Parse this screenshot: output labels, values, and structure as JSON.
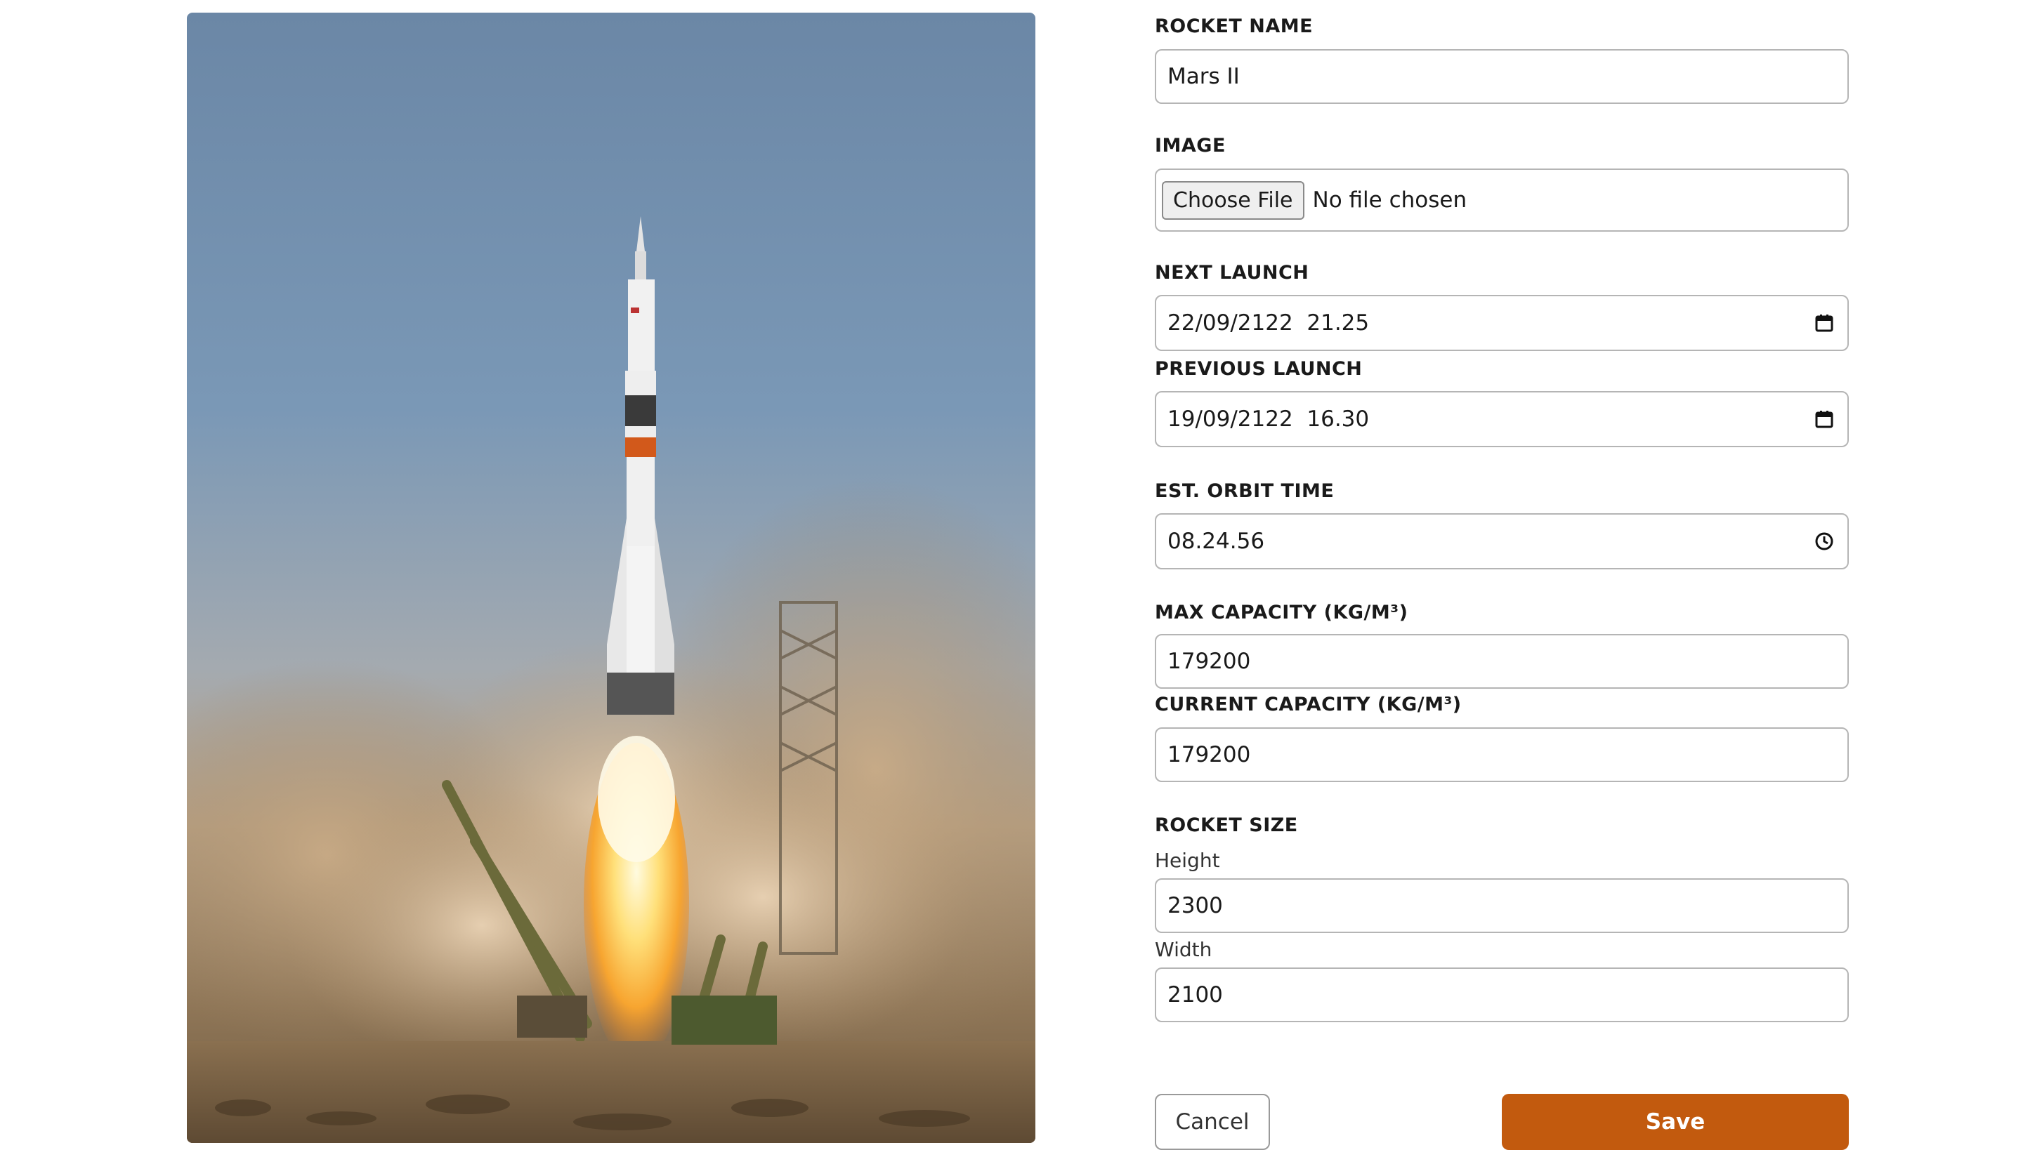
{
  "image": {
    "alt_icon": "rocket-launch-photo"
  },
  "form": {
    "rocket_name": {
      "label": "ROCKET NAME",
      "value": "Mars II"
    },
    "image": {
      "label": "IMAGE",
      "button": "Choose File",
      "status": "No file chosen"
    },
    "next_launch": {
      "label": "NEXT LAUNCH",
      "value": "22/09/2122  21.25",
      "icon": "calendar-icon"
    },
    "previous_launch": {
      "label": "PREVIOUS LAUNCH",
      "value": "19/09/2122  16.30",
      "icon": "calendar-icon"
    },
    "orbit_time": {
      "label": "EST. ORBIT TIME",
      "value": "08.24.56",
      "icon": "clock-icon"
    },
    "max_capacity": {
      "label": "MAX CAPACITY (KG/M³)",
      "value": "179200"
    },
    "current_capacity": {
      "label": "CURRENT CAPACITY (KG/M³)",
      "value": "179200"
    },
    "rocket_size": {
      "label": "ROCKET SIZE",
      "height_label": "Height",
      "height_value": "2300",
      "width_label": "Width",
      "width_value": "2100"
    }
  },
  "actions": {
    "cancel": "Cancel",
    "save": "Save"
  },
  "colors": {
    "accent": "#c25a0e",
    "border": "#b5b5b5"
  }
}
